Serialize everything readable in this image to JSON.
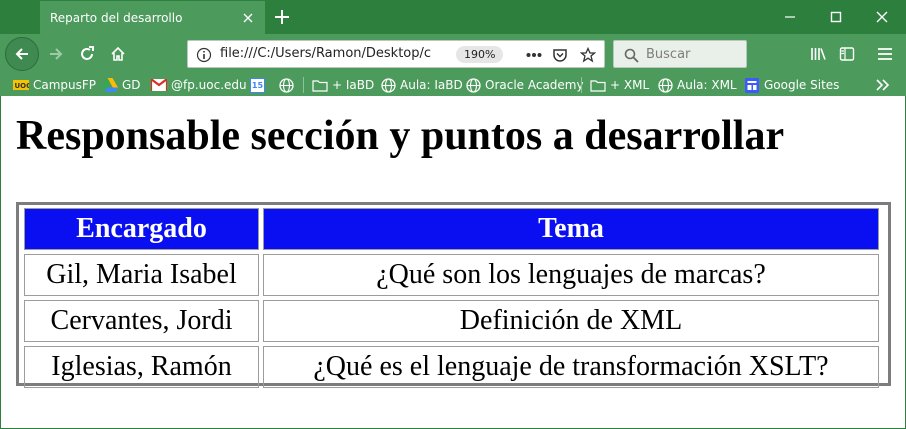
{
  "browser": {
    "tab_title": "Reparto del desarrollo",
    "url": "file:///C:/Users/Ramon/Desktop/c",
    "zoom": "190%",
    "search_placeholder": "Buscar"
  },
  "bookmarks": [
    {
      "label": "CampusFP",
      "icon": "campusfp-icon"
    },
    {
      "label": "GD",
      "icon": "google-drive-icon"
    },
    {
      "label": "@fp.uoc.edu",
      "icon": "gmail-icon"
    },
    {
      "label": "",
      "icon": "calendar-icon",
      "text": "15"
    },
    {
      "label": "",
      "icon": "globe-icon"
    },
    {
      "label": "+ IaBD",
      "icon": "folder-icon"
    },
    {
      "label": "Aula: IaBD",
      "icon": "globe-icon"
    },
    {
      "label": "Oracle Academy",
      "icon": "globe-icon"
    },
    {
      "label": "+ XML",
      "icon": "folder-icon"
    },
    {
      "label": "Aula: XML",
      "icon": "globe-icon"
    },
    {
      "label": "Google Sites",
      "icon": "google-sites-icon"
    }
  ],
  "page": {
    "title": "Responsable sección y puntos a desarrollar",
    "table": {
      "headers": [
        "Encargado",
        "Tema"
      ],
      "rows": [
        [
          "Gil, Maria Isabel",
          "¿Qué son los lenguajes de marcas?"
        ],
        [
          "Cervantes, Jordi",
          "Definición de XML"
        ],
        [
          "Iglesias, Ramón",
          "¿Qué es el lenguaje de transformación XSLT?"
        ]
      ]
    }
  },
  "colors": {
    "chrome": "#4c9a5c",
    "titlebar": "#2d7f3e",
    "header_bg": "#0a0ff2",
    "header_text": "#ffffff"
  }
}
